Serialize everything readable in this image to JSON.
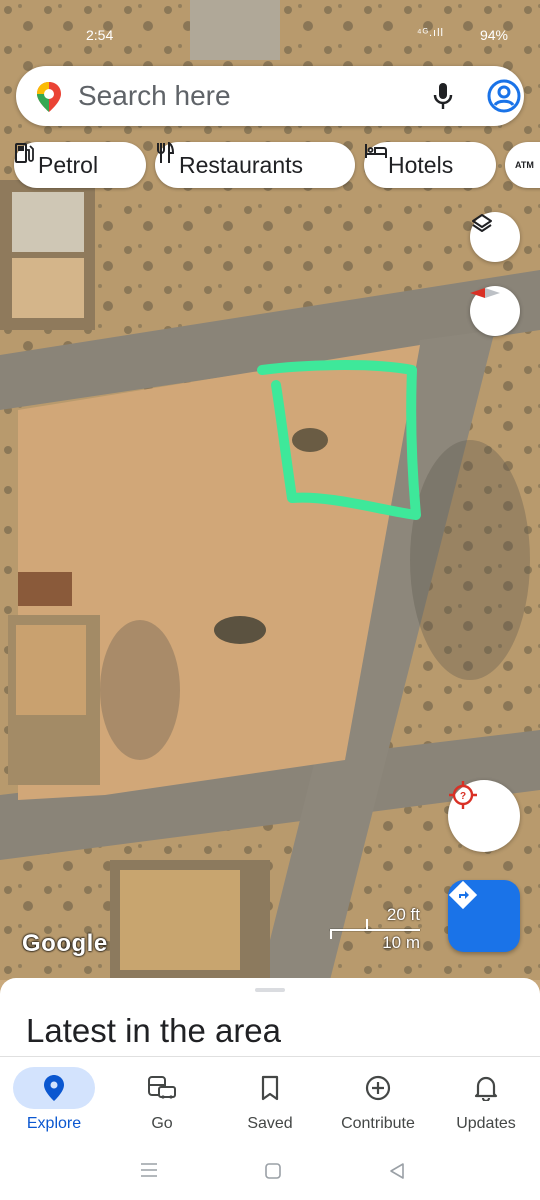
{
  "status_bar": {
    "time": "2:54",
    "signal": "⁴ᴳ.ıll",
    "battery": "94%"
  },
  "search": {
    "placeholder": "Search here",
    "logo_icon": "maps-pin-icon",
    "mic_icon": "mic-icon",
    "account_icon": "account-icon"
  },
  "chips": [
    {
      "label": "Petrol",
      "icon": "gas-station-icon"
    },
    {
      "label": "Restaurants",
      "icon": "fork-knife-icon"
    },
    {
      "label": "Hotels",
      "icon": "bed-icon"
    },
    {
      "label": "ATM",
      "icon": "atm-icon"
    }
  ],
  "map": {
    "attribution": "Google",
    "scale": {
      "feet": "20 ft",
      "meters": "10 m"
    },
    "annotation_color": "#3ee89a",
    "layers_icon": "layers-icon",
    "compass_icon": "compass-icon",
    "location_icon": "my-location-icon",
    "directions_icon": "directions-icon"
  },
  "sheet": {
    "title": "Latest in the area"
  },
  "bottom_nav": [
    {
      "label": "Explore",
      "icon": "explore-pin-icon",
      "active": true
    },
    {
      "label": "Go",
      "icon": "commute-icon",
      "active": false
    },
    {
      "label": "Saved",
      "icon": "bookmark-icon",
      "active": false
    },
    {
      "label": "Contribute",
      "icon": "add-circle-icon",
      "active": false
    },
    {
      "label": "Updates",
      "icon": "bell-icon",
      "active": false
    }
  ],
  "colors": {
    "accent": "#0b57d0",
    "directions_fab": "#1a73e8",
    "active_pill": "#d3e3fd"
  }
}
